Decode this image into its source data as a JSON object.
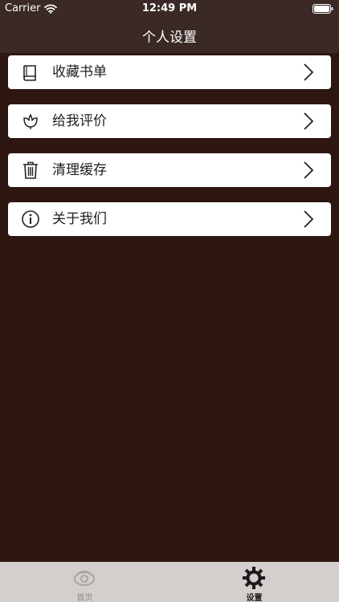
{
  "status_bar": {
    "carrier": "Carrier",
    "time": "12:49 PM"
  },
  "nav": {
    "title": "个人设置"
  },
  "settings": [
    {
      "label": "收藏书单",
      "icon": "book-icon"
    },
    {
      "label": "给我评价",
      "icon": "flower-icon"
    },
    {
      "label": "清理缓存",
      "icon": "trash-icon"
    },
    {
      "label": "关于我们",
      "icon": "info-icon"
    }
  ],
  "tabs": [
    {
      "label": "首页",
      "icon": "home-logo-icon",
      "selected": false
    },
    {
      "label": "设置",
      "icon": "gear-icon",
      "selected": true
    }
  ],
  "colors": {
    "background": "#2e1611",
    "nav_bar": "#3a2925",
    "tab_bar": "#d4cecd"
  }
}
